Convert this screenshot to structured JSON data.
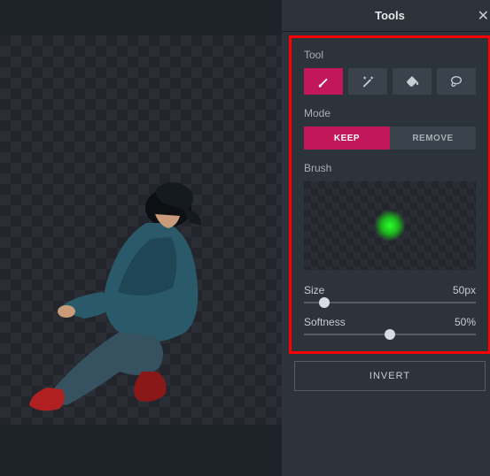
{
  "panel": {
    "title": "Tools",
    "tool_label": "Tool",
    "mode_label": "Mode",
    "brush_label": "Brush",
    "keep_label": "KEEP",
    "remove_label": "REMOVE",
    "invert_label": "INVERT"
  },
  "sliders": {
    "size_label": "Size",
    "size_value": "50px",
    "size_percent": 12,
    "softness_label": "Softness",
    "softness_value": "50%",
    "softness_percent": 50
  },
  "tools": [
    "brush",
    "magic-wand",
    "bucket",
    "lasso"
  ],
  "active_tool": "brush",
  "active_mode": "keep",
  "colors": {
    "accent": "#c2185b",
    "highlight_border": "#ff0000",
    "brush_preview": "#2bff2b"
  }
}
